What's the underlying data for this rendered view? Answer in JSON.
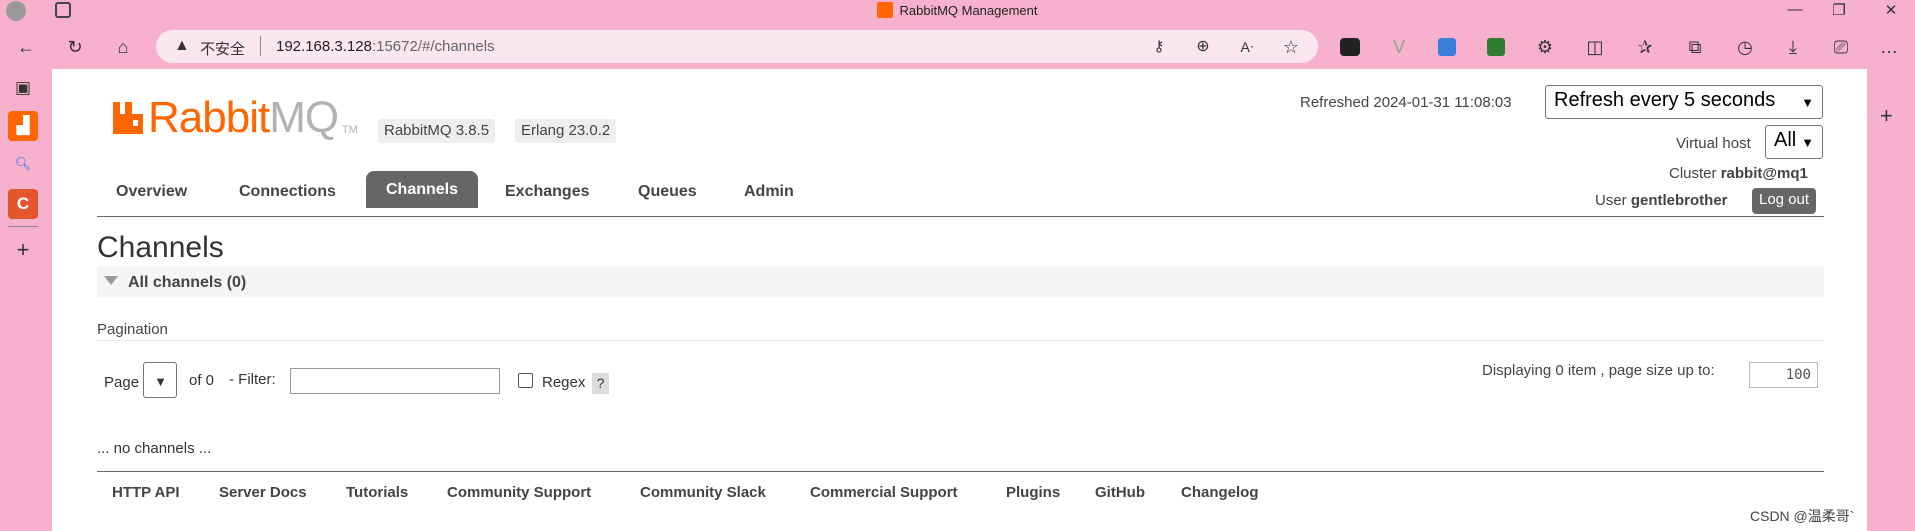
{
  "window": {
    "title": "RabbitMQ Management",
    "minimize": "—",
    "restore": "❐",
    "close": "✕"
  },
  "browser": {
    "security_label": "不安全",
    "url_host": "192.168.3.128",
    "url_path": ":15672/#/channels",
    "icons": [
      "back-icon",
      "refresh-icon",
      "home-icon",
      "key-icon",
      "zoom-icon",
      "read-aloud-icon",
      "favorite-star-icon",
      "extension-icon",
      "favorites-icon",
      "collections-icon",
      "history-icon",
      "download-icon",
      "screenshot-icon",
      "more-icon"
    ]
  },
  "app": {
    "logo_rabbit": "Rabbit",
    "logo_mq": "MQ",
    "logo_tm": "TM",
    "version_rabbitmq": "RabbitMQ 3.8.5",
    "version_erlang": "Erlang 23.0.2",
    "refreshed": "Refreshed 2024-01-31 11:08:03",
    "refresh_interval": "Refresh every 5 seconds",
    "vhost_label": "Virtual host",
    "vhost_value": "All",
    "cluster_label": "Cluster",
    "cluster_value": "rabbit@mq1",
    "user_label": "User",
    "user_value": "gentlebrother",
    "logout": "Log out",
    "accent": "#ff6600"
  },
  "nav": {
    "overview": "Overview",
    "connections": "Connections",
    "channels": "Channels",
    "exchanges": "Exchanges",
    "queues": "Queues",
    "admin": "Admin",
    "active": "Channels"
  },
  "main": {
    "title": "Channels",
    "section_title": "All channels (0)",
    "pagination_label": "Pagination",
    "page_word": "Page",
    "of_text": "of 0",
    "filter_label": "- Filter:",
    "filter_value": "",
    "regex_label": "Regex",
    "help": "?",
    "displaying": "Displaying 0 item , page size up to:",
    "page_size": "100",
    "empty_text": "... no channels ..."
  },
  "footer": {
    "links": [
      "HTTP API",
      "Server Docs",
      "Tutorials",
      "Community Support",
      "Community Slack",
      "Commercial Support",
      "Plugins",
      "GitHub",
      "Changelog"
    ]
  },
  "watermark": "CSDN @温柔哥`"
}
